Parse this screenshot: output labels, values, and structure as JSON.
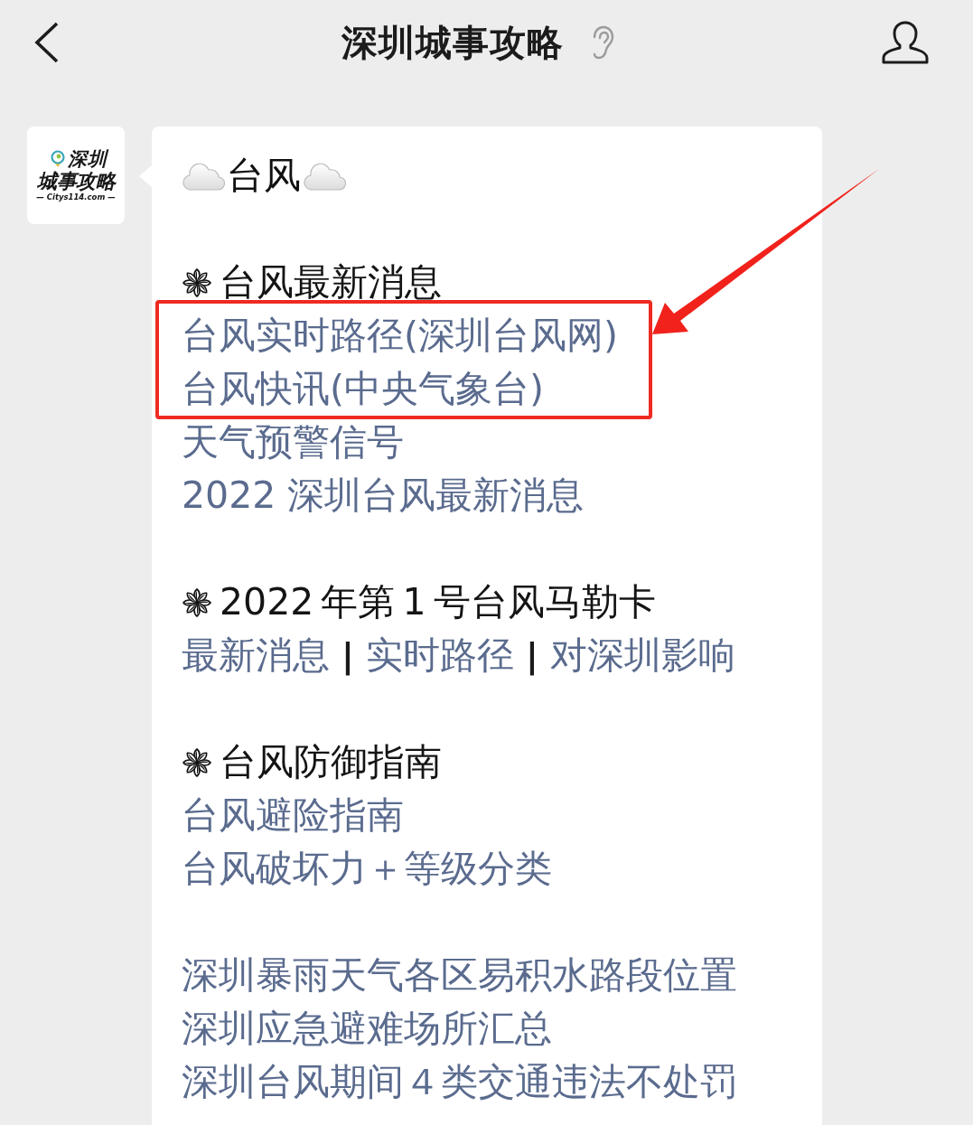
{
  "header": {
    "title": "深圳城事攻略"
  },
  "message": {
    "avatar": {
      "lines": [
        "深圳",
        "城事攻略",
        "— Citys114.com —"
      ]
    },
    "title": "台风",
    "sections": [
      {
        "heading": "台风最新消息",
        "kind": "list",
        "groups": [
          {
            "framed": true,
            "links": [
              "台风实时路径(深圳台风网)",
              "台风快讯(中央气象台)"
            ]
          },
          {
            "framed": false,
            "links": [
              "天气预警信号",
              "2022 深圳台风最新消息"
            ]
          }
        ]
      },
      {
        "heading": "2022 年第 1 号台风马勒卡",
        "kind": "inline",
        "items": [
          {
            "kind": "link",
            "text": "最新消息"
          },
          {
            "kind": "separator",
            "text": "|"
          },
          {
            "kind": "link",
            "text": "实时路径"
          },
          {
            "kind": "separator",
            "text": "|"
          },
          {
            "kind": "link",
            "text": "对深圳影响"
          }
        ]
      },
      {
        "heading": "台风防御指南",
        "kind": "list",
        "links": [
          "台风避险指南",
          "台风破坏力＋等级分类"
        ]
      },
      {
        "kind": "list",
        "links": [
          "深圳暴雨天气各区易积水路段位置",
          "深圳应急避难场所汇总",
          "深圳台风期间４类交通违法不处罚"
        ]
      }
    ]
  }
}
